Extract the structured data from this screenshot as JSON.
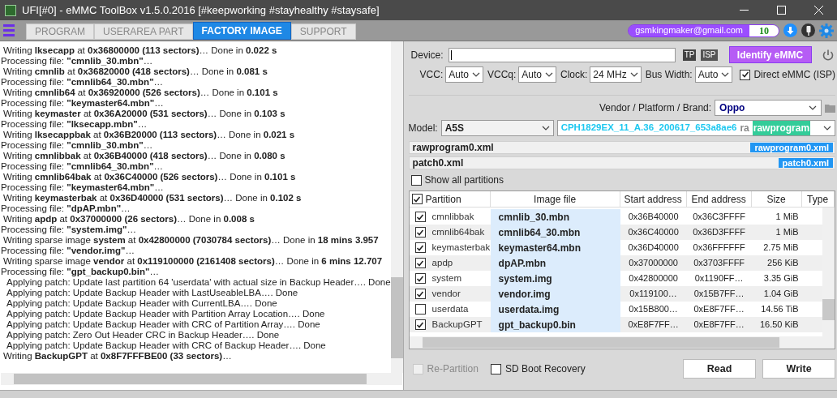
{
  "window": {
    "title": "UFI[#0] - eMMC ToolBox v1.5.0.2016 [#keepworking #stayhealthy #staysafe]"
  },
  "tabs": [
    {
      "label": "PROGRAM",
      "selected": false
    },
    {
      "label": "USERAREA PART",
      "selected": false
    },
    {
      "label": "FACTORY IMAGE",
      "selected": true
    },
    {
      "label": "SUPPORT",
      "selected": false
    }
  ],
  "account": {
    "email": "gsmkingmaker@gmail.com",
    "credits": "10"
  },
  "log": [
    {
      "kind": "write",
      "text": "Writing **lksecapp** at **0x36800000 (113 sectors)**… Done in **0.022 s**"
    },
    {
      "kind": "process",
      "text": "Processing file: **\"cmnlib_30.mbn\"**…"
    },
    {
      "kind": "write",
      "text": "Writing **cmnlib** at **0x36820000 (418 sectors)**… Done in **0.081 s**"
    },
    {
      "kind": "process",
      "text": "Processing file: **\"cmnlib64_30.mbn\"**…"
    },
    {
      "kind": "write",
      "text": "Writing **cmnlib64** at **0x36920000 (526 sectors)**… Done in **0.101 s**"
    },
    {
      "kind": "process",
      "text": "Processing file: **\"keymaster64.mbn\"**…"
    },
    {
      "kind": "write",
      "text": "Writing **keymaster** at **0x36A20000 (531 sectors)**… Done in **0.103 s**"
    },
    {
      "kind": "process",
      "text": "Processing file: **\"lksecapp.mbn\"**…"
    },
    {
      "kind": "write",
      "text": "Writing **lksecappbak** at **0x36B20000 (113 sectors)**… Done in **0.021 s**"
    },
    {
      "kind": "process",
      "text": "Processing file: **\"cmnlib_30.mbn\"**…"
    },
    {
      "kind": "write",
      "text": "Writing **cmnlibbak** at **0x36B40000 (418 sectors)**… Done in **0.080 s**"
    },
    {
      "kind": "process",
      "text": "Processing file: **\"cmnlib64_30.mbn\"**…"
    },
    {
      "kind": "write",
      "text": "Writing **cmnlib64bak** at **0x36C40000 (526 sectors)**… Done in **0.101 s**"
    },
    {
      "kind": "process",
      "text": "Processing file: **\"keymaster64.mbn\"**…"
    },
    {
      "kind": "write",
      "text": "Writing **keymasterbak** at **0x36D40000 (531 sectors)**… Done in **0.102 s**"
    },
    {
      "kind": "process",
      "text": "Processing file: **\"dpAP.mbn\"**…"
    },
    {
      "kind": "write",
      "text": "Writing **apdp** at **0x37000000 (26 sectors)**… Done in **0.008 s**"
    },
    {
      "kind": "process",
      "text": "Processing file: **\"system.img\"**…"
    },
    {
      "kind": "write",
      "text": "Writing sparse image **system** at **0x42800000 (7030784 sectors)**… Done in **18 mins 3.957**"
    },
    {
      "kind": "process",
      "text": "Processing file: **\"vendor.img\"**…"
    },
    {
      "kind": "write",
      "text": "Writing sparse image **vendor** at **0x119100000 (2161408 sectors)**… Done in **6 mins 12.707**"
    },
    {
      "kind": "process",
      "text": "Processing file: **\"gpt_backup0.bin\"**…"
    },
    {
      "kind": "patch",
      "text": "Applying patch: Update last partition 64 'userdata' with actual size in Backup Header…. Done"
    },
    {
      "kind": "patch",
      "text": "Applying patch: Update Backup Header with LastUseableLBA…. Done"
    },
    {
      "kind": "patch",
      "text": "Applying patch: Update Backup Header with CurrentLBA…. Done"
    },
    {
      "kind": "patch",
      "text": "Applying patch: Update Backup Header with Partition Array Location…. Done"
    },
    {
      "kind": "patch",
      "text": "Applying patch: Update Backup Header with CRC of Partition Array…. Done"
    },
    {
      "kind": "patch",
      "text": "Applying patch: Zero Out Header CRC in Backup Header…. Done"
    },
    {
      "kind": "patch",
      "text": "Applying patch: Update Backup Header with CRC of Backup Header…. Done"
    },
    {
      "kind": "write",
      "text": "Writing **BackupGPT** at **0x8F7FFFBE00 (33 sectors)**…"
    }
  ],
  "device": {
    "label": "Device:",
    "tp": "TP",
    "isp": "ISP",
    "identify": "Identify eMMC"
  },
  "selects": [
    {
      "label": "VCC:",
      "value": "Auto"
    },
    {
      "label": "VCCq:",
      "value": "Auto"
    },
    {
      "label": "Clock:",
      "value": "24 MHz"
    },
    {
      "label": "Bus Width:",
      "value": "Auto"
    }
  ],
  "direct_isp": {
    "label": "Direct eMMC (ISP)",
    "checked": true
  },
  "brand": {
    "label": "Vendor / Platform / Brand:",
    "value": "Oppo"
  },
  "model": {
    "label": "Model:",
    "value": "A5S",
    "firmware": "CPH1829EX_11_A.36_200617_653a8ae6",
    "firmware_suffix": "ra",
    "tag": "rawprogram"
  },
  "files": [
    {
      "name": "rawprogram0.xml",
      "tag": "rawprogram0.xml"
    },
    {
      "name": "patch0.xml",
      "tag": "patch0.xml"
    }
  ],
  "show_all": {
    "label": "Show all partitions",
    "checked": false
  },
  "table": {
    "all_checked": true,
    "columns": [
      "Partition",
      "Image file",
      "Start address",
      "End address",
      "Size",
      "Type"
    ],
    "rows": [
      {
        "checked": true,
        "partition": "cmnlibbak",
        "file": "cmnlib_30.mbn",
        "start": "0x36B40000",
        "end": "0x36C3FFFF",
        "size": "1 MiB"
      },
      {
        "checked": true,
        "partition": "cmnlib64bak",
        "file": "cmnlib64_30.mbn",
        "start": "0x36C40000",
        "end": "0x36D3FFFF",
        "size": "1 MiB"
      },
      {
        "checked": true,
        "partition": "keymasterbak",
        "file": "keymaster64.mbn",
        "start": "0x36D40000",
        "end": "0x36FFFFFF",
        "size": "2.75 MiB"
      },
      {
        "checked": true,
        "partition": "apdp",
        "file": "dpAP.mbn",
        "start": "0x37000000",
        "end": "0x3703FFFF",
        "size": "256 KiB"
      },
      {
        "checked": true,
        "partition": "system",
        "file": "system.img",
        "start": "0x42800000",
        "end": "0x1190FF…",
        "size": "3.35 GiB"
      },
      {
        "checked": true,
        "partition": "vendor",
        "file": "vendor.img",
        "start": "0x119100…",
        "end": "0x15B7FF…",
        "size": "1.04 GiB"
      },
      {
        "checked": false,
        "partition": "userdata",
        "file": "userdata.img",
        "start": "0x15B800…",
        "end": "0xE8F7FF…",
        "size": "14.56 TiB"
      },
      {
        "checked": true,
        "partition": "BackupGPT",
        "file": "gpt_backup0.bin",
        "start": "0xE8F7FF…",
        "end": "0xE8F7FF…",
        "size": "16.50 KiB"
      }
    ]
  },
  "options": [
    {
      "label": "Re-Partition",
      "checked": false,
      "disabled": true
    },
    {
      "label": "SD Boot Recovery",
      "checked": false,
      "disabled": false
    }
  ],
  "buttons": [
    "Read",
    "Write"
  ]
}
